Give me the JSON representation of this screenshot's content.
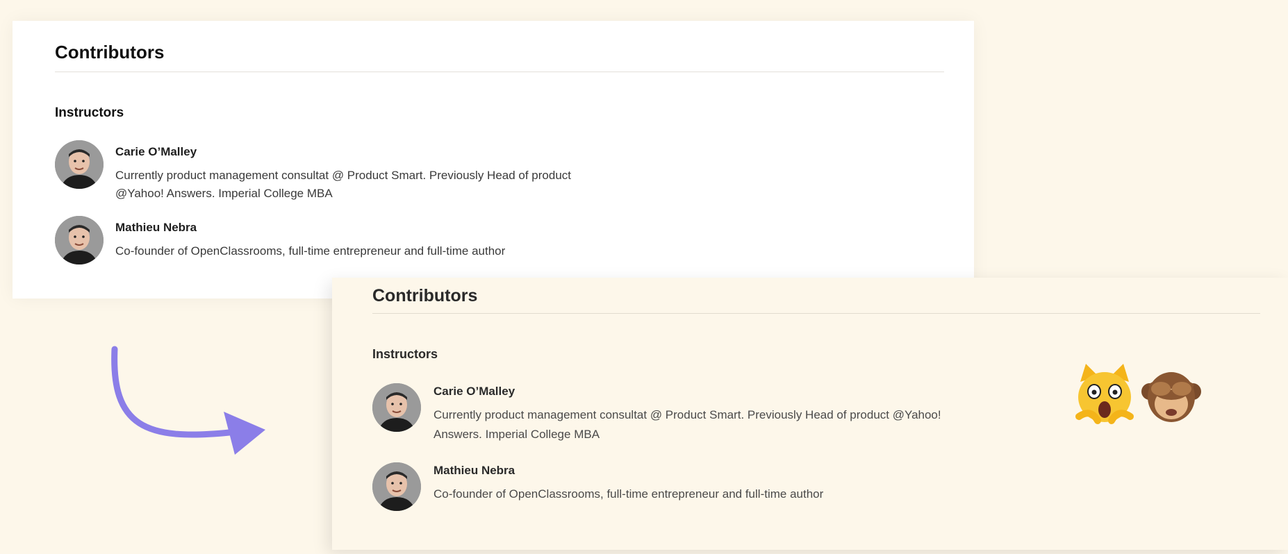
{
  "before": {
    "title": "Contributors",
    "section": "Instructors",
    "people": [
      {
        "name": "Carie O’Malley",
        "bio_lines": [
          "Currently product management consultat @ Product Smart. Previously Head of product",
          "@Yahoo! Answers. Imperial College MBA"
        ]
      },
      {
        "name": "Mathieu Nebra",
        "bio_lines": [
          "Co-founder of OpenClassrooms, full-time entrepreneur and full-time author"
        ]
      }
    ]
  },
  "after": {
    "title": "Contributors",
    "section": "Instructors",
    "people": [
      {
        "name": "Carie O’Malley",
        "bio_lines": [
          "Currently product management consultat @ Product Smart. Previously Head of product @Yahoo!",
          "Answers. Imperial College MBA"
        ]
      },
      {
        "name": "Mathieu Nebra",
        "bio_lines": [
          "Co-founder of OpenClassrooms, full-time entrepreneur and full-time author"
        ]
      }
    ]
  },
  "decorations": {
    "arrow_color": "#8b7ee8",
    "emojis": [
      "scream-cat-icon",
      "see-no-evil-monkey-icon"
    ]
  }
}
